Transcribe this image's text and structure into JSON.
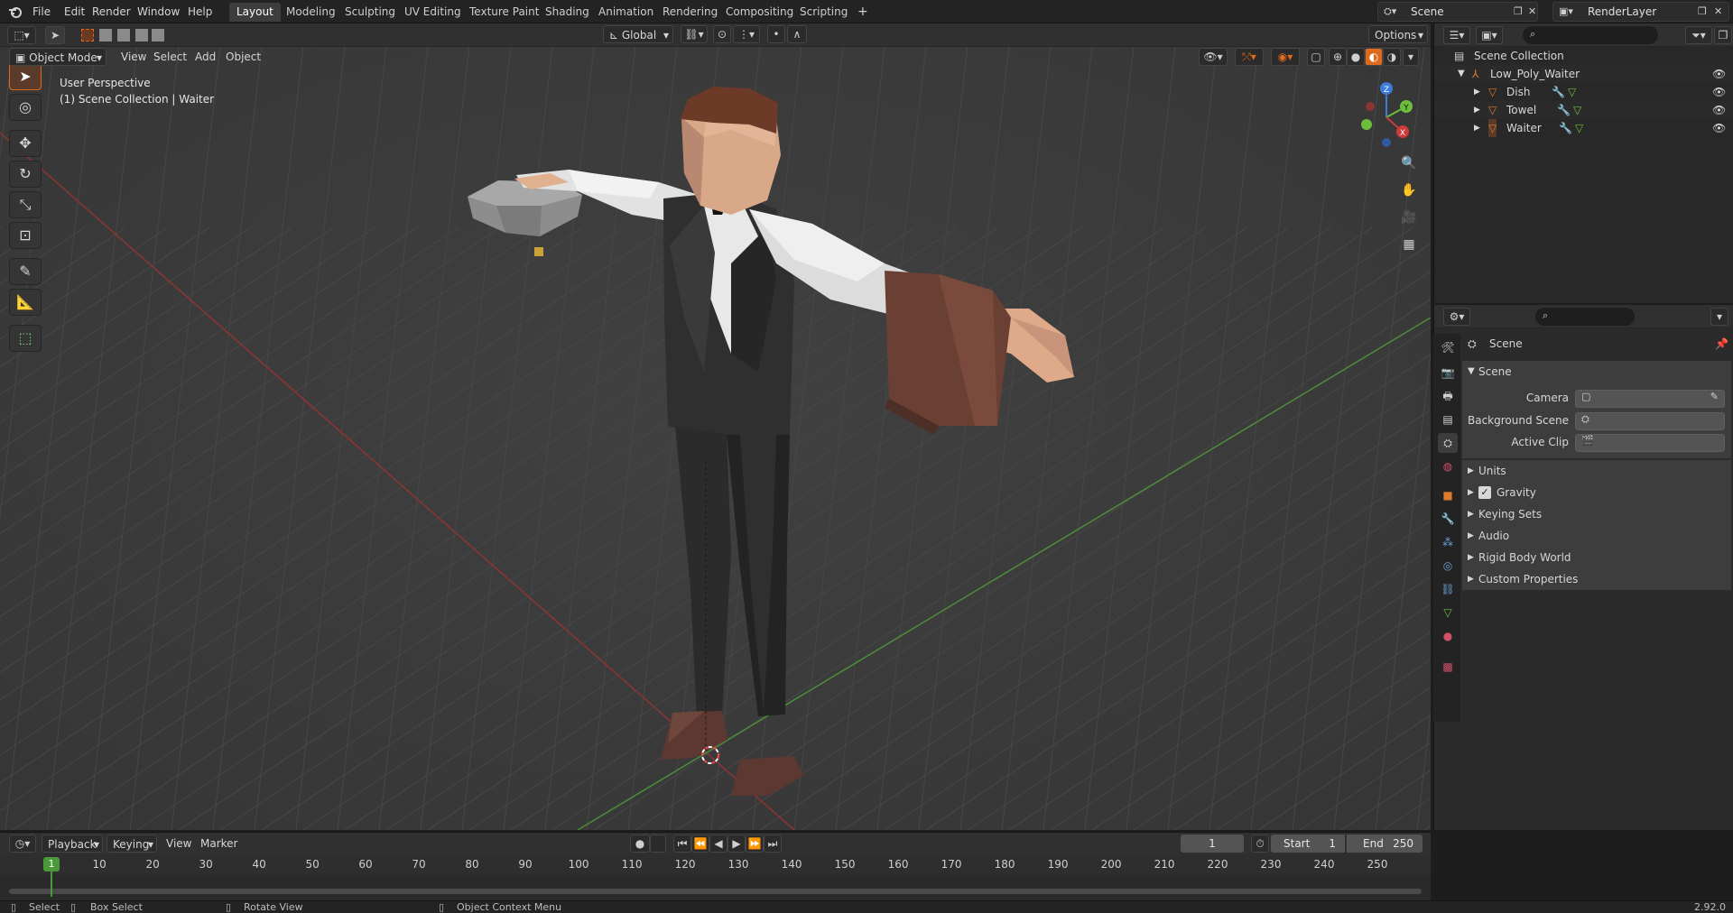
{
  "top_menu": {
    "items": [
      "File",
      "Edit",
      "Render",
      "Window",
      "Help"
    ],
    "workspaces": [
      "Layout",
      "Modeling",
      "Sculpting",
      "UV Editing",
      "Texture Paint",
      "Shading",
      "Animation",
      "Rendering",
      "Compositing",
      "Scripting"
    ],
    "active_workspace": "Layout",
    "add_tab": "+",
    "scene_name": "Scene",
    "render_layer": "RenderLayer"
  },
  "viewport_header": {
    "mode": "Object Mode",
    "menus": [
      "View",
      "Select",
      "Add",
      "Object"
    ],
    "transform_orientation": "Global",
    "options_label": "Options"
  },
  "viewport": {
    "perspective_label": "User Perspective",
    "collection_label": "(1) Scene Collection | Waiter",
    "gizmo_axes": [
      "X",
      "Y",
      "Z"
    ]
  },
  "outliner": {
    "root": "Scene Collection",
    "collection": "Low_Poly_Waiter",
    "objects": [
      "Dish",
      "Towel",
      "Waiter"
    ]
  },
  "properties": {
    "context_title": "Scene",
    "panel_title": "Scene",
    "fields": [
      {
        "label": "Camera"
      },
      {
        "label": "Background Scene"
      },
      {
        "label": "Active Clip"
      }
    ],
    "subpanels": [
      "Units",
      "Gravity",
      "Keying Sets",
      "Audio",
      "Rigid Body World",
      "Custom Properties"
    ],
    "gravity_checked": true
  },
  "timeline": {
    "menus": [
      "Playback",
      "Keying",
      "View",
      "Marker"
    ],
    "current_frame": "1",
    "start_label": "Start",
    "start_value": "1",
    "end_label": "End",
    "end_value": "250",
    "ruler": [
      "1",
      "10",
      "20",
      "30",
      "40",
      "50",
      "60",
      "70",
      "80",
      "90",
      "100",
      "110",
      "120",
      "130",
      "140",
      "150",
      "160",
      "170",
      "180",
      "190",
      "200",
      "210",
      "220",
      "230",
      "240",
      "250"
    ]
  },
  "statusbar": {
    "select": "Select",
    "box_select": "Box Select",
    "rotate_view": "Rotate View",
    "context_menu": "Object Context Menu",
    "version": "2.92.0"
  },
  "colors": {
    "accent": "#e06a1b",
    "x_axis": "#cc3a3a",
    "y_axis": "#6cbf3a",
    "z_axis": "#3a7cd8"
  }
}
